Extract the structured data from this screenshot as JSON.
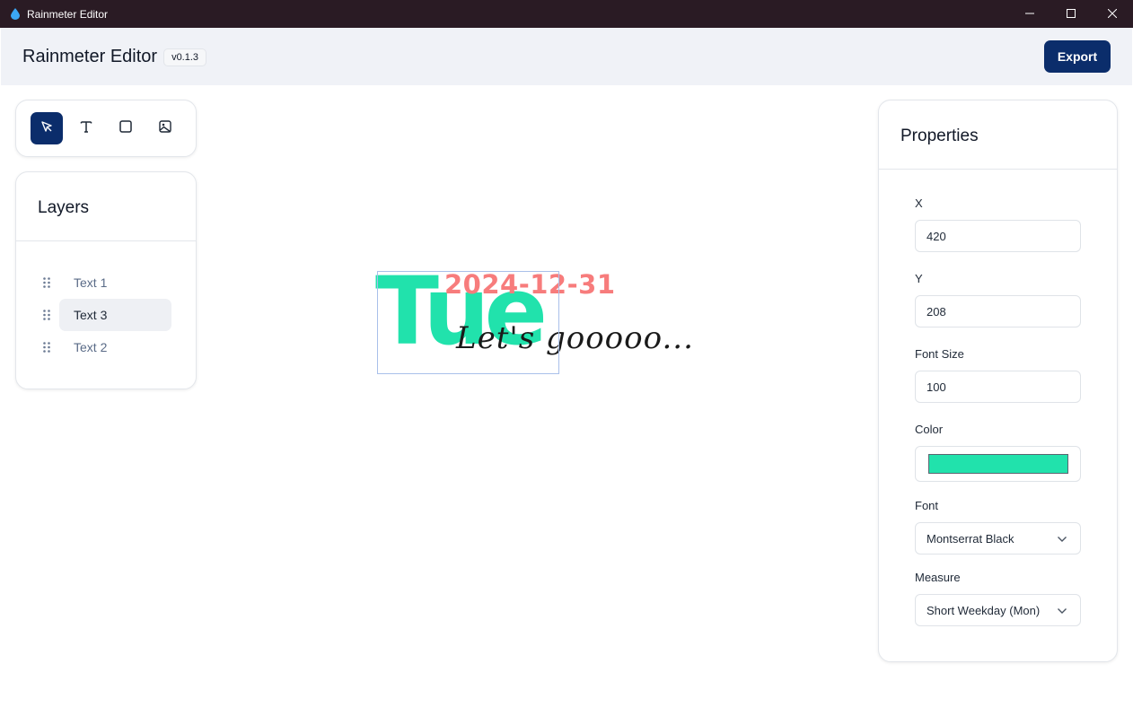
{
  "window": {
    "title": "Rainmeter Editor",
    "icon": "water-drop-icon"
  },
  "header": {
    "title": "Rainmeter Editor",
    "version": "v0.1.3",
    "export_label": "Export"
  },
  "tools": [
    {
      "name": "select-tool",
      "icon": "cursor-arrow-icon",
      "active": true
    },
    {
      "name": "text-tool",
      "icon": "text-t-icon",
      "active": false
    },
    {
      "name": "rectangle-tool",
      "icon": "square-icon",
      "active": false
    },
    {
      "name": "image-tool",
      "icon": "image-icon",
      "active": false
    }
  ],
  "layers": {
    "heading": "Layers",
    "items": [
      {
        "label": "Text 1",
        "selected": false
      },
      {
        "label": "Text 3",
        "selected": true
      },
      {
        "label": "Text 2",
        "selected": false
      }
    ]
  },
  "canvas": {
    "date_text": "2024-12-31",
    "weekday_text": "Tue",
    "tagline_text": "Let's gooooo...",
    "colors": {
      "date": "#f77c7c",
      "weekday": "#21e2ac",
      "tagline": "#1a1a1a"
    }
  },
  "properties": {
    "heading": "Properties",
    "x_label": "X",
    "x_value": "420",
    "y_label": "Y",
    "y_value": "208",
    "font_size_label": "Font Size",
    "font_size_value": "100",
    "color_label": "Color",
    "color_value": "#21e2ac",
    "font_label": "Font",
    "font_value": "Montserrat Black",
    "measure_label": "Measure",
    "measure_value": "Short Weekday (Mon)"
  },
  "theme": {
    "accent": "#0b2d6b",
    "titlebar": "#2a1b24",
    "header_bg": "#f0f2f7"
  }
}
